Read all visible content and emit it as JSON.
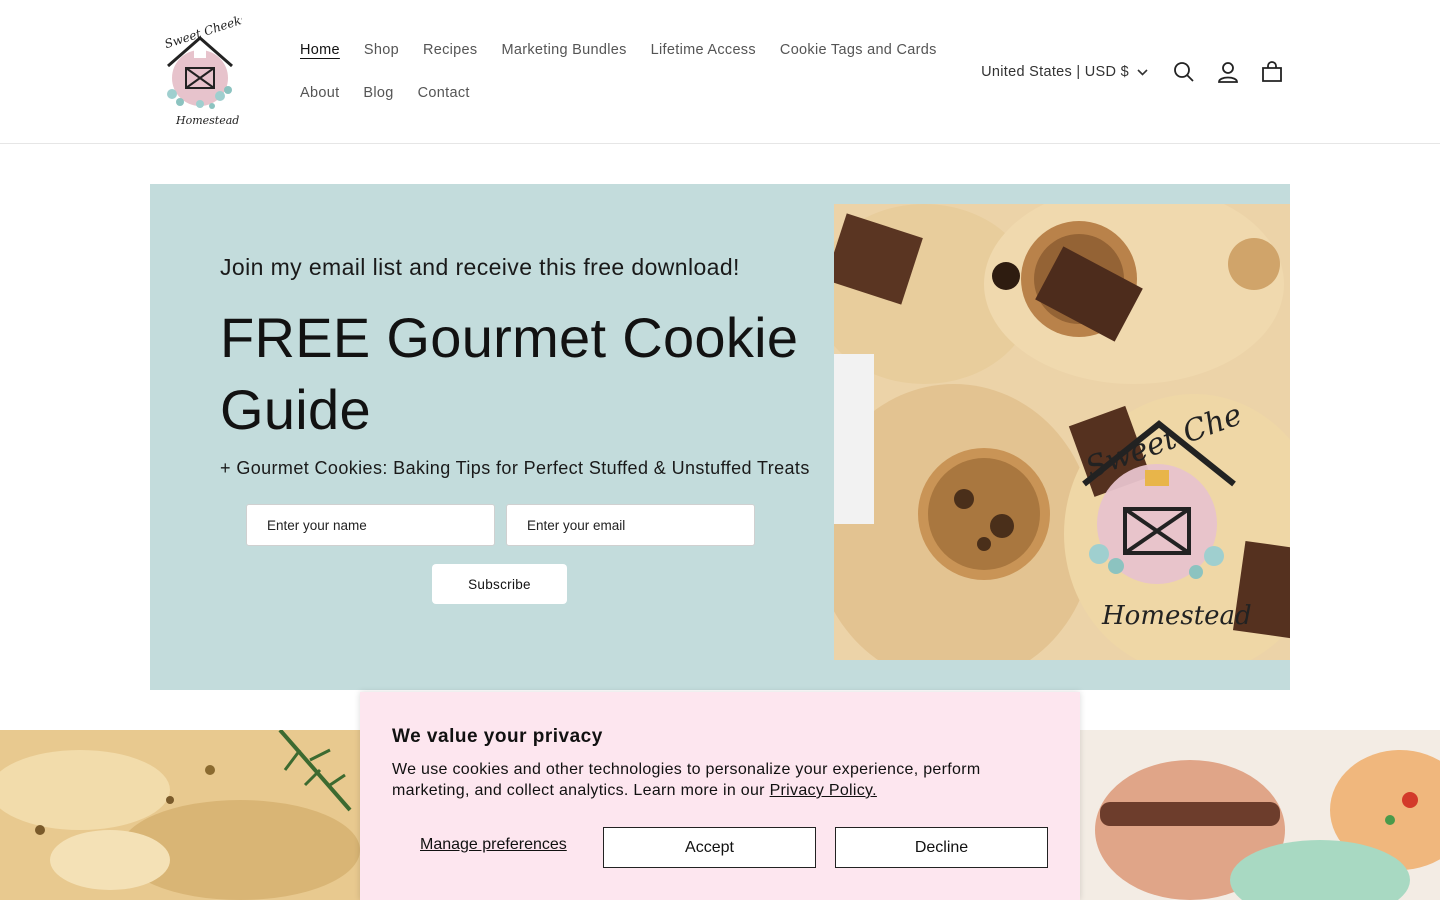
{
  "header": {
    "logo_alt": "Sweet Cheeks Homestead",
    "nav_row1": [
      "Home",
      "Shop",
      "Recipes",
      "Marketing Bundles",
      "Lifetime Access",
      "Cookie Tags and Cards"
    ],
    "nav_row2": [
      "About",
      "Blog",
      "Contact"
    ],
    "locale": "United States | USD $",
    "icons": [
      "search-icon",
      "account-icon",
      "cart-icon"
    ]
  },
  "hero": {
    "pretitle": "Join my email list and receive this free download!",
    "title": "FREE Gourmet Cookie Guide",
    "subtitle": "+ Gourmet Cookies: Baking Tips for Perfect Stuffed & Unstuffed Treats",
    "name_placeholder": "Enter your name",
    "email_placeholder": "Enter your email",
    "subscribe_label": "Subscribe",
    "background_color": "#c3dcdc"
  },
  "cookie_banner": {
    "title": "We value your privacy",
    "text": "We use cookies and other technologies to personalize your experience, perform marketing, and collect analytics. Learn more in our ",
    "link": "Privacy Policy.",
    "manage_label": "Manage preferences",
    "accept_label": "Accept",
    "decline_label": "Decline",
    "background_color": "#fde6ef"
  }
}
